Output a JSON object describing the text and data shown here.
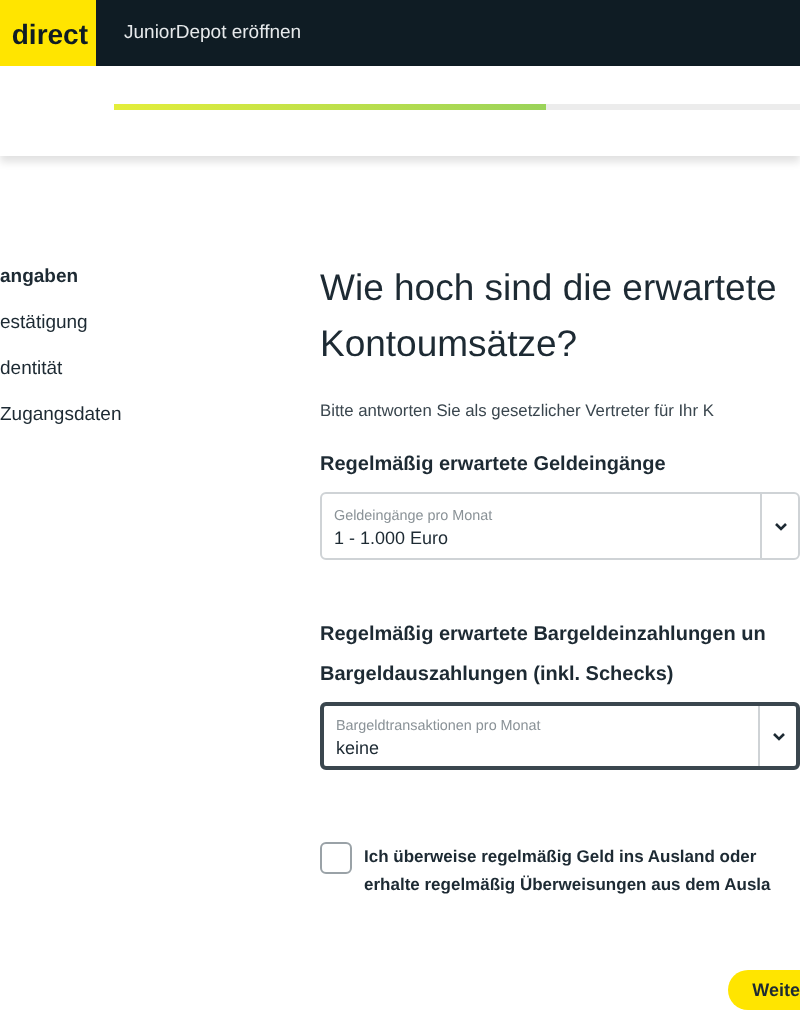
{
  "header": {
    "logo": "direct",
    "title": "JuniorDepot eröffnen"
  },
  "progress": {
    "level": 0.63
  },
  "sidebar": {
    "items": [
      {
        "label": "angaben",
        "selected": true
      },
      {
        "label": "estätigung",
        "selected": false
      },
      {
        "label": "dentität",
        "selected": false
      },
      {
        "label": "Zugangsdaten",
        "selected": false
      }
    ]
  },
  "main": {
    "title": [
      "Wie hoch sind die erwartete",
      "Kontoumsätze?"
    ],
    "intro": "Bitte antworten Sie als gesetzlicher Vertreter für Ihr K",
    "sections": [
      {
        "heading": [
          "Regelmäßig erwartete Geldeingänge"
        ],
        "select": {
          "label": "Geldeingänge pro Monat",
          "value": "1 - 1.000 Euro",
          "focused": false
        }
      },
      {
        "heading": [
          "Regelmäßig erwartete Bargeldeinzahlungen un",
          "Bargeldauszahlungen (inkl. Schecks)"
        ],
        "select": {
          "label": "Bargeldtransaktionen pro Monat",
          "value": "keine",
          "focused": true
        }
      }
    ],
    "checkbox": {
      "checked": false,
      "lines": [
        "Ich überweise regelmäßig Geld ins Ausland oder",
        "erhalte regelmäßig Überweisungen aus dem Ausla"
      ]
    },
    "button": "Weite"
  }
}
